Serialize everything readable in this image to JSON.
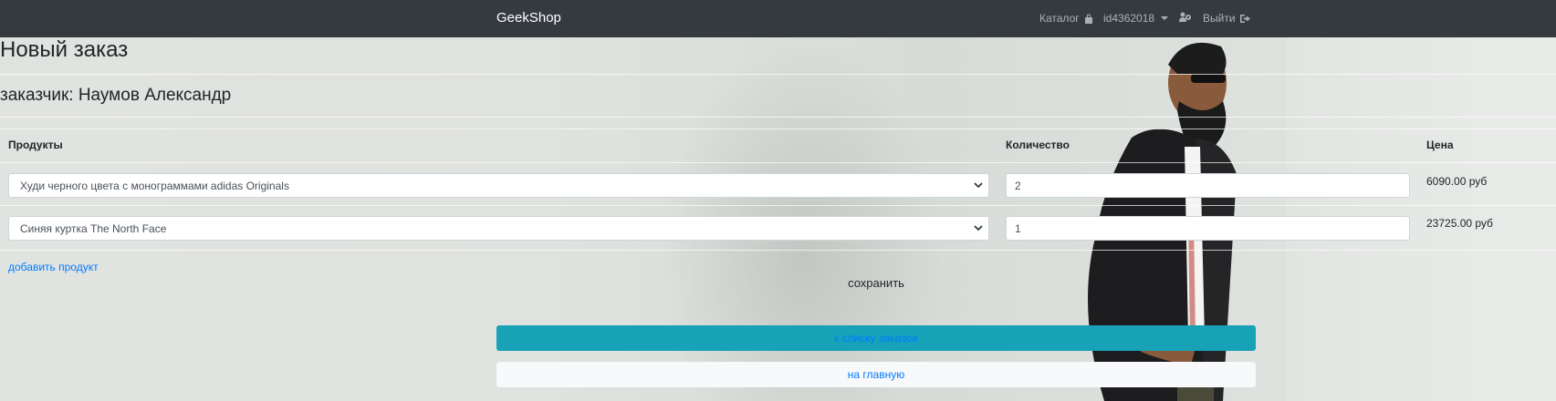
{
  "navbar": {
    "brand": "GeekShop",
    "catalog": "Каталог",
    "user": "id4362018",
    "logout": "Выйти"
  },
  "page": {
    "title": "Новый заказ",
    "customer": "заказчик: Наумов Александр"
  },
  "table": {
    "headers": [
      "Продукты",
      "Количество",
      "Цена"
    ],
    "rows": [
      {
        "product": "Худи черного цвета с монограммами adidas Originals",
        "quantity": "2",
        "price": "6090.00 руб"
      },
      {
        "product": "Синяя куртка The North Face",
        "quantity": "1",
        "price": "23725.00 руб"
      }
    ]
  },
  "actions": {
    "add_product": "добавить продукт",
    "save": "сохранить",
    "to_orders": "к списку заказов",
    "to_home": "на главную"
  },
  "colors": {
    "navbar": "#343a40",
    "info_button": "#17a2b8",
    "link": "#007bff"
  },
  "icons": {
    "catalog": "shopping-bag-icon",
    "users": "users-cog-icon",
    "logout": "sign-out-icon",
    "select_arrow": "chevron-down-icon"
  }
}
